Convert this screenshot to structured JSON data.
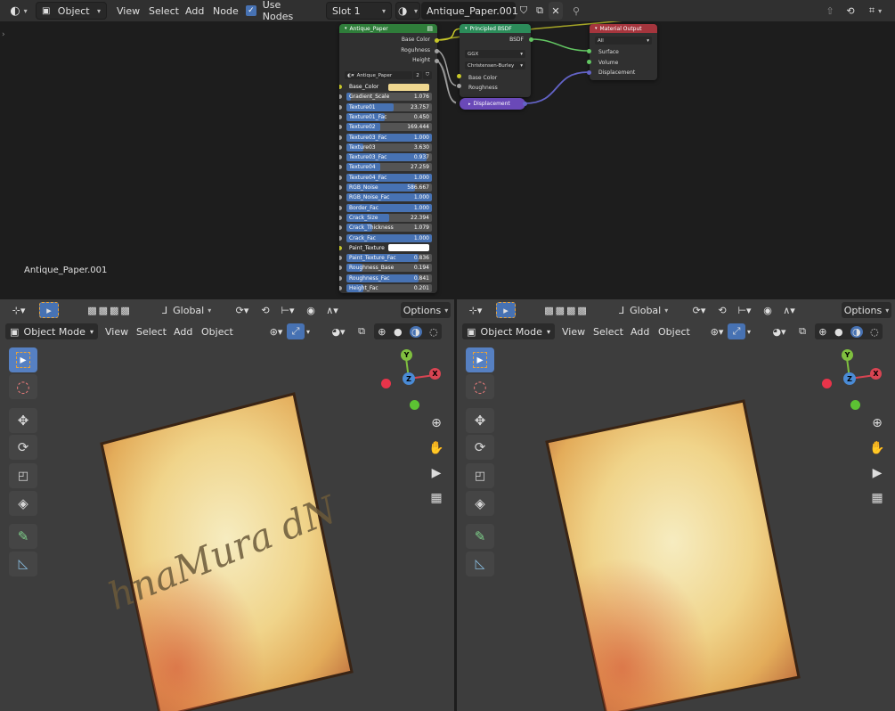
{
  "topbar": {
    "editor_mode": "Object",
    "menus": [
      "View",
      "Select",
      "Add",
      "Node"
    ],
    "use_nodes_label": "Use Nodes",
    "use_nodes_checked": true,
    "slot": "Slot 1",
    "material_name": "Antique_Paper.001"
  },
  "node_editor": {
    "label": "Antique_Paper.001",
    "group_node": {
      "title": "Antique_Paper",
      "outputs": [
        "Base Color",
        "Roguhness",
        "Height"
      ],
      "datablock": "Antique_Paper",
      "users": "2",
      "inputs": [
        {
          "name": "Base_Color",
          "value": "",
          "kind": "color",
          "color": "#f0d890"
        },
        {
          "name": "Gradient_Scale",
          "value": "1.076",
          "fill": 0.05
        },
        {
          "name": "Texture01",
          "value": "23.757",
          "fill": 0.55
        },
        {
          "name": "Texture01_Fac",
          "value": "0.450",
          "fill": 0.45
        },
        {
          "name": "Texture02",
          "value": "169.444",
          "fill": 0.4
        },
        {
          "name": "Texture03_Fac",
          "value": "1.000",
          "fill": 1
        },
        {
          "name": "Texture03",
          "value": "3.630",
          "fill": 0.2
        },
        {
          "name": "Texture03_Fac",
          "value": "0.937",
          "fill": 0.94
        },
        {
          "name": "Texture04",
          "value": "27.259",
          "fill": 0.4
        },
        {
          "name": "Texture04_Fac",
          "value": "1.000",
          "fill": 1
        },
        {
          "name": "RGB_Noise",
          "value": "586.667",
          "fill": 0.8
        },
        {
          "name": "RGB_Noise_Fac",
          "value": "1.000",
          "fill": 1
        },
        {
          "name": "Border_Fac",
          "value": "1.000",
          "fill": 1
        },
        {
          "name": "Crack_Size",
          "value": "22.394",
          "fill": 0.5
        },
        {
          "name": "Crack_Thickness",
          "value": "1.079",
          "fill": 0.3
        },
        {
          "name": "Crack_Fac",
          "value": "1.000",
          "fill": 1
        },
        {
          "name": "Paint_Texture",
          "value": "",
          "kind": "color",
          "color": "#ffffff"
        },
        {
          "name": "Paint_Texture_Fac",
          "value": "0.836",
          "fill": 0.84
        },
        {
          "name": "Roughness_Base",
          "value": "0.194",
          "fill": 0.19
        },
        {
          "name": "Roughness_Fac",
          "value": "0.841",
          "fill": 0.84
        },
        {
          "name": "Height_Fac",
          "value": "0.201",
          "fill": 0.2
        }
      ]
    },
    "bsdf_node": {
      "title": "Principled BSDF",
      "output": "BSDF",
      "distribution": "GGX",
      "subsurface": "Christensen-Burley",
      "inputs": [
        "Base Color",
        "Roughness"
      ]
    },
    "displacement_node": {
      "title": "Displacement"
    },
    "output_node": {
      "title": "Material Output",
      "target": "All",
      "inputs": [
        "Surface",
        "Volume",
        "Displacement"
      ]
    }
  },
  "viewport_header": {
    "orientation": "Global",
    "options": "Options",
    "mode": "Object Mode",
    "menus": [
      "View",
      "Select",
      "Add",
      "Object"
    ]
  },
  "viewport_left": {
    "paper_text": "hnaMura dN"
  },
  "gizmo": {
    "y": "Y",
    "z": "Z",
    "x": "X"
  },
  "colors": {
    "header_bg": "#303030",
    "node_group": "#2f7d3a",
    "node_shader": "#2c8c5a",
    "node_output": "#a5353d",
    "node_vector": "#6a49b8",
    "active_tool": "#5680c2"
  }
}
